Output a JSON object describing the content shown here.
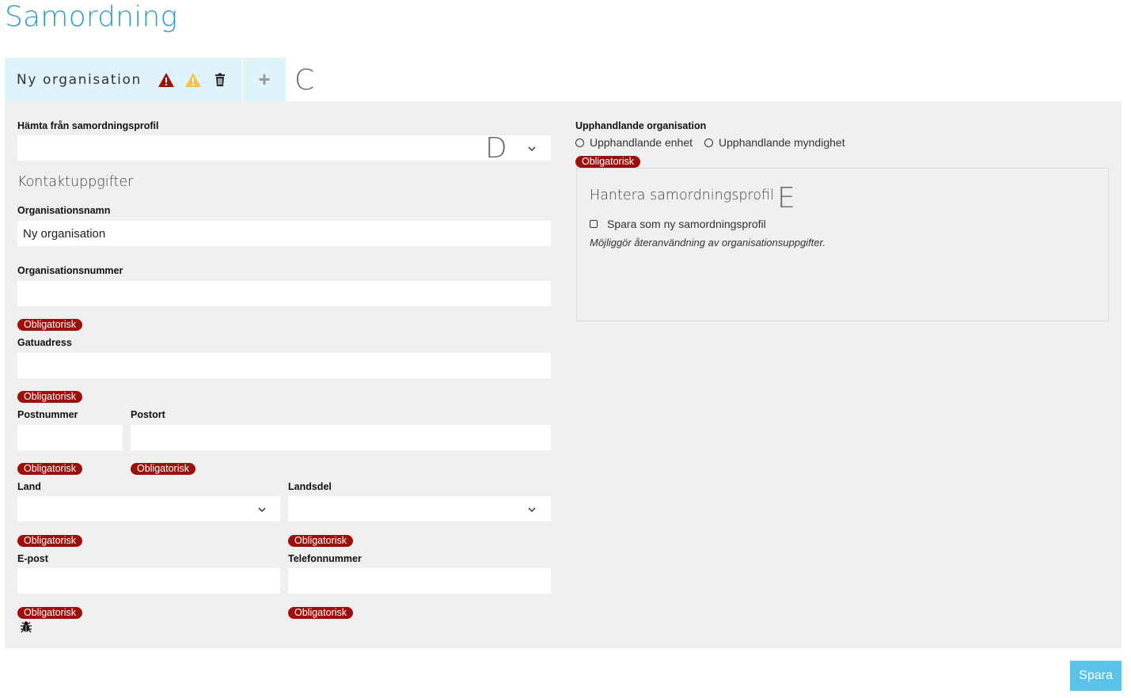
{
  "page": {
    "title": "Samordning"
  },
  "tabs": [
    {
      "label": "Ny organisation",
      "icons": [
        "error-triangle-icon",
        "warning-triangle-icon",
        "trash-icon"
      ]
    }
  ],
  "add_tab_label": "+",
  "markers": {
    "c": "C",
    "d": "D",
    "e": "E"
  },
  "form": {
    "profile_select_label": "Hämta från samordningsprofil",
    "profile_select_value": "",
    "contact_heading": "Kontaktuppgifter",
    "org_name_label": "Organisationsnamn",
    "org_name_value": "Ny organisation",
    "org_number_label": "Organisationsnummer",
    "org_number_value": "",
    "street_label": "Gatuadress",
    "street_value": "",
    "postcode_label": "Postnummer",
    "postcode_value": "",
    "city_label": "Postort",
    "city_value": "",
    "country_label": "Land",
    "country_value": "",
    "region_label": "Landsdel",
    "region_value": "",
    "email_label": "E-post",
    "email_value": "",
    "phone_label": "Telefonnummer",
    "phone_value": "",
    "required_badge": "Obligatorisk"
  },
  "procuring": {
    "label": "Upphandlande organisation",
    "options": [
      "Upphandlande enhet",
      "Upphandlande myndighet"
    ]
  },
  "profile_box": {
    "heading": "Hantera samordningsprofil",
    "checkbox_label": "Spara som ny samordningsprofil",
    "hint": "Möjliggör återanvändning av organisationsuppgifter."
  },
  "debug_icon": "bug-icon",
  "save_button": "Spara",
  "colors": {
    "title": "#2f9bc4",
    "tab_bg": "#dff3fb",
    "panel_bg": "#efefef",
    "required_badge": "#9b0f0c",
    "error_icon": "#a0100c",
    "warning_icon": "#f6c445",
    "save_button": "#5cc2ea"
  }
}
